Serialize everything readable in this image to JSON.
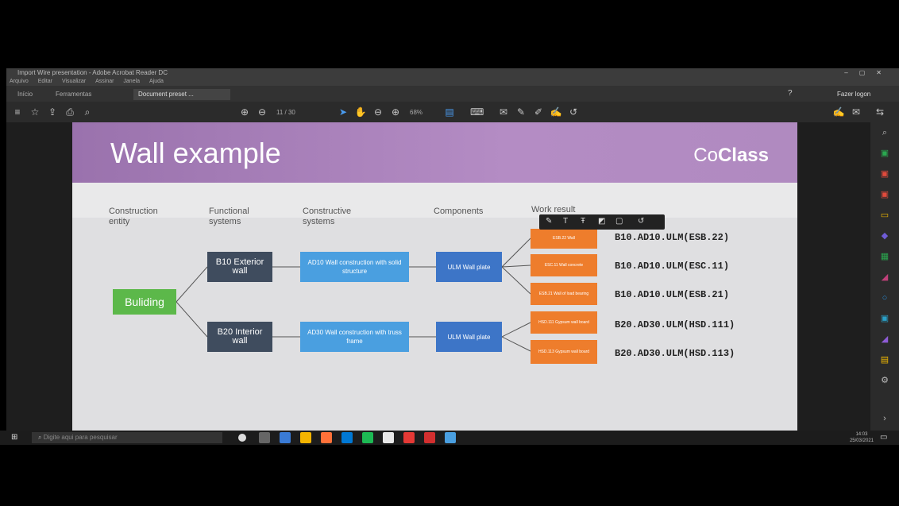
{
  "window": {
    "title": "Import Wire presentation - Adobe Acrobat Reader DC",
    "menu": [
      "Arquivo",
      "Editar",
      "Visualizar",
      "Assinar",
      "Janela",
      "Ajuda"
    ],
    "tabs": [
      "Início",
      "Ferramentas",
      "Document preset ..."
    ],
    "sign_in": "Fazer logon",
    "help_icon": "?"
  },
  "toolbar": {
    "page": "11 / 30",
    "zoom": "68%"
  },
  "slide": {
    "title": "Wall example",
    "brand_prefix": "Co",
    "brand_bold": "Class",
    "columns": [
      "Construction entity",
      "Functional systems",
      "Constructive systems",
      "Components",
      "Work result"
    ],
    "root": "Buliding",
    "functional": [
      "B10 Exterior wall",
      "B20 Interior wall"
    ],
    "constructive": [
      "AD10 Wall construction with solid structure",
      "AD30 Wall construction with truss frame"
    ],
    "components": [
      "ULM Wall plate",
      "ULM Wall plate"
    ],
    "work_results": [
      "ESB.22 Wall",
      "ESC.11 Wall concrete",
      "ESB.21 Wall of load bearing",
      "HSD.111 Gypsum wall board",
      "HSD.113 Gypsum wall board"
    ],
    "codes": [
      "B10.AD10.ULM(ESB.22)",
      "B10.AD10.ULM(ESC.11)",
      "B10.AD10.ULM(ESB.21)",
      "B20.AD30.ULM(HSD.111)",
      "B20.AD30.ULM(HSD.113)"
    ]
  },
  "taskbar": {
    "search_placeholder": "Digite aqui para pesquisar",
    "time": "14:03",
    "date": "25/03/2021"
  },
  "colors": {
    "header": "#a77fb9",
    "dark_node": "#3f4c5e",
    "light_blue": "#4a9fe0",
    "mid_blue": "#3d75c7",
    "orange": "#ee7d2c",
    "green": "#5cb84a"
  }
}
